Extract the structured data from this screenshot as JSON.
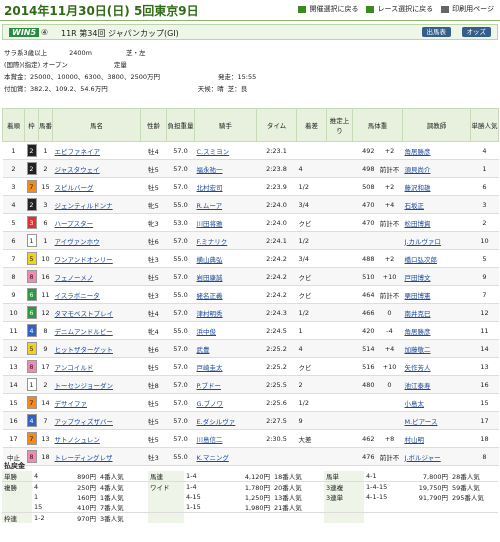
{
  "header": {
    "title": "2014年11月30日(日) 5回東京9日",
    "links": [
      {
        "label": "開催選択に戻る",
        "icon": "back-square-icon"
      },
      {
        "label": "レース選択に戻る",
        "icon": "back-square-icon"
      },
      {
        "label": "印刷用ページ",
        "icon": "printer-icon"
      }
    ]
  },
  "race": {
    "logo": "WIN5",
    "win5_no": "④",
    "number_name": "11R 第34回 ジャパンカップ(GI)",
    "btn_entries": "出馬表",
    "btn_odds": "オッズ",
    "line1_left": "サラ系3歳以上",
    "distance": "2400m",
    "course": "芝・左",
    "line2_left": "(国際)(指定) オープン",
    "weight_rule": "定量",
    "prize_label": "本賞金：",
    "prize": "25000、10000、6300、3800、2500万円",
    "start_label": "発走：",
    "start_time": "15:55",
    "added_label": "付加賞：",
    "added": "382.2、109.2、54.6万円",
    "weather": "天候：晴",
    "going": "芝：良"
  },
  "table": {
    "headers": [
      "着順",
      "枠",
      "馬番",
      "馬名",
      "性齢",
      "負担重量",
      "騎手",
      "タイム",
      "着差",
      "推定上り",
      "馬体重",
      "",
      "調教師",
      "単勝人気"
    ],
    "rows": [
      {
        "pos": "1",
        "frame": "2",
        "no": "1",
        "name": "エピファネイア",
        "sex": "牡4",
        "wt": "57.0",
        "jockey": "C.スミヨン",
        "time": "2:23.1",
        "margin": "",
        "last": "",
        "bw": "492",
        "diff": "+2",
        "trainer": "角居勝彦",
        "pop": "4"
      },
      {
        "pos": "2",
        "frame": "2",
        "no": "2",
        "name": "ジャスタウェイ",
        "sex": "牡5",
        "wt": "57.0",
        "jockey": "福永祐一",
        "time": "2:23.8",
        "margin": "4",
        "last": "",
        "bw": "498",
        "diff": "前計不",
        "trainer": "須貝尚介",
        "pop": "1"
      },
      {
        "pos": "3",
        "frame": "7",
        "no": "15",
        "name": "スピルバーグ",
        "sex": "牡5",
        "wt": "57.0",
        "jockey": "北村宏司",
        "time": "2:23.9",
        "margin": "1/2",
        "last": "",
        "bw": "508",
        "diff": "+2",
        "trainer": "藤沢和雄",
        "pop": "6"
      },
      {
        "pos": "4",
        "frame": "2",
        "no": "3",
        "name": "ジェンティルドンナ",
        "sex": "牝5",
        "wt": "55.0",
        "jockey": "R.ムーア",
        "time": "2:24.0",
        "margin": "3/4",
        "last": "",
        "bw": "470",
        "diff": "+4",
        "trainer": "石坂正",
        "pop": "3"
      },
      {
        "pos": "5",
        "frame": "3",
        "no": "6",
        "name": "ハープスター",
        "sex": "牝3",
        "wt": "53.0",
        "jockey": "川田将雅",
        "time": "2:24.0",
        "margin": "クビ",
        "last": "",
        "bw": "470",
        "diff": "前計不",
        "trainer": "松田博資",
        "pop": "2"
      },
      {
        "pos": "6",
        "frame": "1",
        "no": "1",
        "name": "アイヴァンホウ",
        "sex": "牡6",
        "wt": "57.0",
        "jockey": "F.ミナリク",
        "time": "2:24.1",
        "margin": "1/2",
        "last": "",
        "bw": "",
        "diff": "",
        "trainer": "J.カルヴァロ",
        "pop": "10"
      },
      {
        "pos": "7",
        "frame": "5",
        "no": "10",
        "name": "ワンアンドオンリー",
        "sex": "牡3",
        "wt": "55.0",
        "jockey": "横山典弘",
        "time": "2:24.2",
        "margin": "3/4",
        "last": "",
        "bw": "488",
        "diff": "+2",
        "trainer": "橋口弘次郎",
        "pop": "5"
      },
      {
        "pos": "8",
        "frame": "8",
        "no": "16",
        "name": "フェノーメノ",
        "sex": "牡5",
        "wt": "57.0",
        "jockey": "岩田康誠",
        "time": "2:24.2",
        "margin": "クビ",
        "last": "",
        "bw": "510",
        "diff": "+10",
        "trainer": "戸田博文",
        "pop": "9"
      },
      {
        "pos": "9",
        "frame": "6",
        "no": "11",
        "name": "イスラボニータ",
        "sex": "牡3",
        "wt": "55.0",
        "jockey": "蛯名正義",
        "time": "2:24.2",
        "margin": "クビ",
        "last": "",
        "bw": "464",
        "diff": "前計不",
        "trainer": "栗田博憲",
        "pop": "7"
      },
      {
        "pos": "10",
        "frame": "6",
        "no": "12",
        "name": "タマモベストプレイ",
        "sex": "牡4",
        "wt": "57.0",
        "jockey": "津村明秀",
        "time": "2:24.3",
        "margin": "1/2",
        "last": "",
        "bw": "466",
        "diff": "0",
        "trainer": "南井克巳",
        "pop": "12"
      },
      {
        "pos": "11",
        "frame": "4",
        "no": "8",
        "name": "デニムアンドルビー",
        "sex": "牝4",
        "wt": "55.0",
        "jockey": "浜中俊",
        "time": "2:24.5",
        "margin": "1",
        "last": "",
        "bw": "420",
        "diff": "-4",
        "trainer": "角居勝彦",
        "pop": "11"
      },
      {
        "pos": "12",
        "frame": "5",
        "no": "9",
        "name": "ヒットザターゲット",
        "sex": "牡6",
        "wt": "57.0",
        "jockey": "武豊",
        "time": "2:25.2",
        "margin": "4",
        "last": "",
        "bw": "514",
        "diff": "+4",
        "trainer": "加藤敬二",
        "pop": "14"
      },
      {
        "pos": "13",
        "frame": "8",
        "no": "17",
        "name": "アンコイルド",
        "sex": "牡5",
        "wt": "57.0",
        "jockey": "戸崎圭太",
        "time": "2:25.2",
        "margin": "クビ",
        "last": "",
        "bw": "516",
        "diff": "+10",
        "trainer": "矢作芳人",
        "pop": "13"
      },
      {
        "pos": "14",
        "frame": "1",
        "no": "2",
        "name": "トーセンジョーダン",
        "sex": "牡8",
        "wt": "57.0",
        "jockey": "P.ブドー",
        "time": "2:25.5",
        "margin": "2",
        "last": "",
        "bw": "480",
        "diff": "0",
        "trainer": "池江泰寿",
        "pop": "16"
      },
      {
        "pos": "15",
        "frame": "7",
        "no": "14",
        "name": "デサイファ",
        "sex": "牡5",
        "wt": "57.0",
        "jockey": "G.ブノワ",
        "time": "2:25.6",
        "margin": "1/2",
        "last": "",
        "bw": "",
        "diff": "",
        "trainer": "小島太",
        "pop": "15"
      },
      {
        "pos": "16",
        "frame": "4",
        "no": "7",
        "name": "アップウィズザバー",
        "sex": "牡5",
        "wt": "57.0",
        "jockey": "E.ダシルヴァ",
        "time": "2:27.5",
        "margin": "9",
        "last": "",
        "bw": "",
        "diff": "",
        "trainer": "M.ピアース",
        "pop": "17"
      },
      {
        "pos": "17",
        "frame": "7",
        "no": "13",
        "name": "サトノシュレン",
        "sex": "牡5",
        "wt": "57.0",
        "jockey": "川島信二",
        "time": "2:30.5",
        "margin": "大差",
        "last": "",
        "bw": "462",
        "diff": "+8",
        "trainer": "村山明",
        "pop": "18"
      },
      {
        "pos": "中止",
        "frame": "8",
        "no": "18",
        "name": "トレーディングレザ",
        "sex": "牡3",
        "wt": "55.0",
        "jockey": "K.マニング",
        "time": "",
        "margin": "",
        "last": "",
        "bw": "476",
        "diff": "前計不",
        "trainer": "J.ボルジャー",
        "pop": "8"
      }
    ]
  },
  "payout": {
    "heading": "払戻金",
    "rows": [
      [
        "単勝",
        "4",
        "890円",
        "4番人気",
        "馬連",
        "1-4",
        "4,120円",
        "18番人気",
        "馬単",
        "4-1",
        "7,800円",
        "28番人気"
      ],
      [
        "複勝",
        "4",
        "250円",
        "4番人気",
        "ワイド",
        "1-4",
        "1,780円",
        "20番人気",
        "3連複",
        "1-4-15",
        "19,750円",
        "59番人気"
      ],
      [
        "",
        "1",
        "160円",
        "1番人気",
        "",
        "4-15",
        "1,250円",
        "13番人気",
        "3連単",
        "4-1-15",
        "91,790円",
        "295番人気"
      ],
      [
        "",
        "15",
        "410円",
        "7番人気",
        "",
        "1-15",
        "1,980円",
        "21番人気",
        "",
        "",
        "",
        ""
      ],
      [
        "枠連",
        "1-2",
        "970円",
        "3番人気",
        "",
        "",
        "",
        "",
        "",
        "",
        "",
        ""
      ]
    ]
  },
  "colors": {
    "frame_1": "#ffffff",
    "frame_2": "#222222",
    "frame_3": "#e3312d",
    "frame_4": "#2f62c7",
    "frame_5": "#f3d31a",
    "frame_6": "#2b9a3f",
    "frame_7": "#f28b1a",
    "frame_8": "#f28ab4",
    "accent": "#2f6b16"
  }
}
